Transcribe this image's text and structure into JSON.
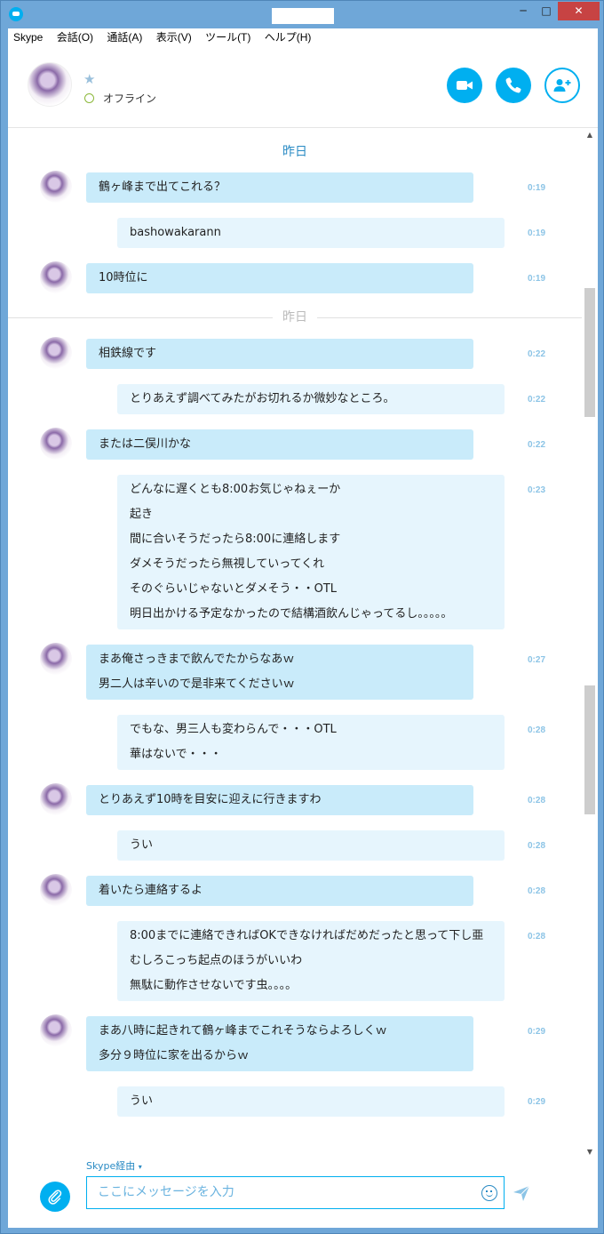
{
  "window": {
    "minimize": "─",
    "maximize": "□",
    "close": "✕"
  },
  "menu": [
    "Skype",
    "会話(O)",
    "通話(A)",
    "表示(V)",
    "ツール(T)",
    "ヘルプ(H)"
  ],
  "contact": {
    "status": "オフライン",
    "favorite_icon": "star-icon"
  },
  "dates": {
    "first": "昨日",
    "second": "昨日"
  },
  "messages": [
    {
      "dir": "in",
      "lines": [
        "鶴ヶ峰まで出てこれる？"
      ],
      "time": "0:19"
    },
    {
      "dir": "out",
      "lines": [
        "bashowakarann"
      ],
      "time": "0:19"
    },
    {
      "dir": "in",
      "lines": [
        "10時位に"
      ],
      "time": "0:19"
    },
    {
      "dir": "in",
      "lines": [
        "相鉄線です"
      ],
      "time": "0:22"
    },
    {
      "dir": "out",
      "lines": [
        "とりあえず調べてみたがお切れるか微妙なところ。"
      ],
      "time": "0:22"
    },
    {
      "dir": "in",
      "lines": [
        "または二俣川かな"
      ],
      "time": "0:22"
    },
    {
      "dir": "out",
      "lines": [
        "どんなに遅くとも8:00お気じゃねぇーか",
        "起き",
        "間に合いそうだったら8:00に連絡します",
        "ダメそうだったら無視していってくれ",
        "そのぐらいじゃないとダメそう・・OTL",
        "明日出かける予定なかったので結構酒飲んじゃってるし。。。。。"
      ],
      "time": "0:23"
    },
    {
      "dir": "in",
      "lines": [
        "まあ俺さっきまで飲んでたからなあｗ",
        "男二人は辛いので是非来てくださいｗ"
      ],
      "time": "0:27"
    },
    {
      "dir": "out",
      "lines": [
        "でもな、男三人も変わらんで・・・OTL",
        "華はないで・・・"
      ],
      "time": "0:28"
    },
    {
      "dir": "in",
      "lines": [
        "とりあえず10時を目安に迎えに行きますわ"
      ],
      "time": "0:28"
    },
    {
      "dir": "out",
      "lines": [
        "うい"
      ],
      "time": "0:28"
    },
    {
      "dir": "in",
      "lines": [
        "着いたら連絡するよ"
      ],
      "time": "0:28"
    },
    {
      "dir": "out",
      "lines": [
        "8:00までに連絡できればOKできなければだめだったと思って下し亜",
        "むしろこっち起点のほうがいいわ",
        "無駄に動作させないです虫。。。。"
      ],
      "time": "0:28"
    },
    {
      "dir": "in",
      "lines": [
        "まあ八時に起きれて鶴ヶ峰までこれそうならよろしくｗ",
        "多分９時位に家を出るからｗ"
      ],
      "time": "0:29"
    },
    {
      "dir": "out",
      "lines": [
        "うい"
      ],
      "time": "0:29"
    }
  ],
  "composer": {
    "via_label": "Skype経由",
    "via_arrow": "▾",
    "placeholder": "ここにメッセージを入力"
  },
  "colors": {
    "accent": "#00aff0",
    "incoming_bubble": "#c9ebfa",
    "outgoing_bubble": "#e6f5fd",
    "timestamp": "#8cc4e6"
  }
}
